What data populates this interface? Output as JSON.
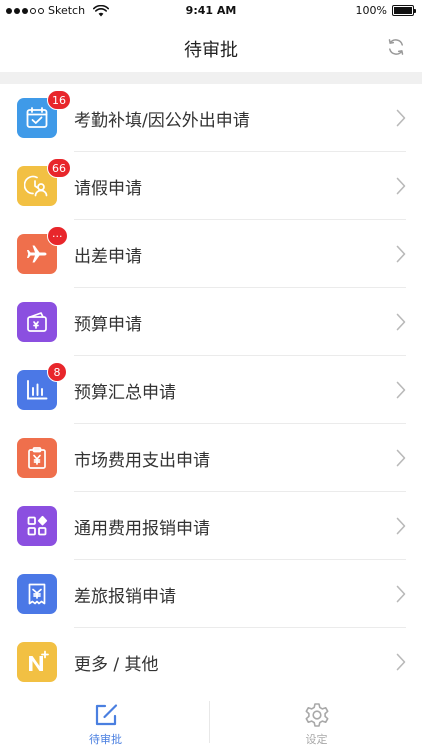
{
  "status_bar": {
    "carrier": "Sketch",
    "time": "9:41 AM",
    "battery_text": "100%",
    "battery_level": 1.0
  },
  "nav": {
    "title": "待审批",
    "refresh_icon": "refresh-icon"
  },
  "colors": {
    "accent": "#4a7fe0",
    "badge": "#e8262b",
    "chevron": "#b9b9b9"
  },
  "list": {
    "items": [
      {
        "label": "考勤补填/因公外出申请",
        "icon": "calendar-check-icon",
        "icon_color": "#3f9ae8",
        "badge": "16"
      },
      {
        "label": "请假申请",
        "icon": "leave-person-icon",
        "icon_color": "#f2c043",
        "badge": "66"
      },
      {
        "label": "出差申请",
        "icon": "airplane-icon",
        "icon_color": "#ef6f4c",
        "badge": "···"
      },
      {
        "label": "预算申请",
        "icon": "wallet-icon",
        "icon_color": "#8b4fe0",
        "badge": ""
      },
      {
        "label": "预算汇总申请",
        "icon": "bar-chart-icon",
        "icon_color": "#4b78e6",
        "badge": "8"
      },
      {
        "label": "市场费用支出申请",
        "icon": "clipboard-yen-icon",
        "icon_color": "#ef6f4c",
        "badge": ""
      },
      {
        "label": "通用费用报销申请",
        "icon": "grid-apps-icon",
        "icon_color": "#8b4fe0",
        "badge": ""
      },
      {
        "label": "差旅报销申请",
        "icon": "receipt-icon",
        "icon_color": "#4b78e6",
        "badge": ""
      },
      {
        "label": "更多 / 其他",
        "icon": "n-plus-icon",
        "icon_color": "#f2c043",
        "badge": ""
      }
    ]
  },
  "tab_bar": {
    "tabs": [
      {
        "label": "待审批",
        "icon": "edit-square-icon",
        "active": true
      },
      {
        "label": "设定",
        "icon": "settings-gear-icon",
        "active": false
      }
    ]
  }
}
